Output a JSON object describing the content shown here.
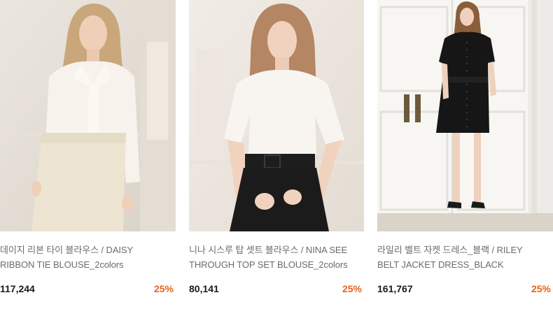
{
  "products": [
    {
      "name_line1": "데이지 리본 타이 블라우스 / DAISY",
      "name_line2": "RIBBON TIE BLOUSE_2colors",
      "price": "117,244",
      "discount": "25%"
    },
    {
      "name_line1": "니나 시스루 탑 셋트 블라우스 / NINA SEE",
      "name_line2": "THROUGH TOP SET BLOUSE_2colors",
      "price": "80,141",
      "discount": "25%"
    },
    {
      "name_line1": "라일리 벨트 자켓 드레스_블랙 / RILEY",
      "name_line2": "BELT JACKET DRESS_BLACK",
      "price": "161,767",
      "discount": "25%"
    }
  ],
  "colors": {
    "discount": "#e8631c",
    "price": "#1a1a1a",
    "name": "#6b6b6b"
  }
}
